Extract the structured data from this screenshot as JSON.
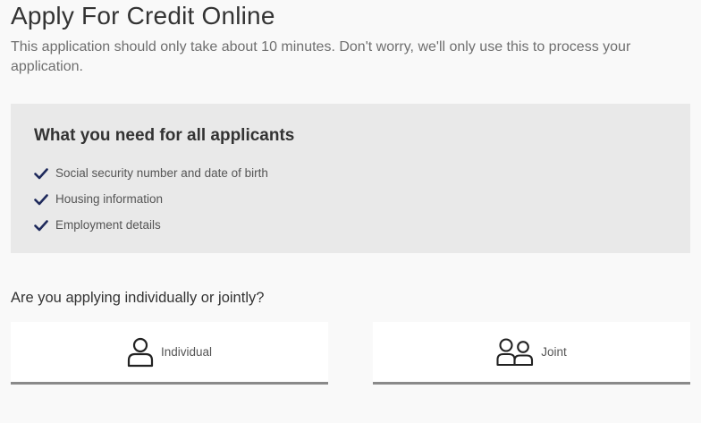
{
  "page": {
    "title": "Apply For Credit Online",
    "subtitle": "This application should only take about 10 minutes. Don't worry, we'll only use this to process your application."
  },
  "requirements": {
    "heading": "What you need for all applicants",
    "items": [
      {
        "label": "Social security number and date of birth",
        "icon": "check-icon"
      },
      {
        "label": "Housing information",
        "icon": "check-icon"
      },
      {
        "label": "Employment details",
        "icon": "check-icon"
      }
    ],
    "check_color": "#1f2a5c"
  },
  "applicant_type": {
    "question": "Are you applying individually or jointly?",
    "options": [
      {
        "label": "Individual",
        "icon": "person-icon"
      },
      {
        "label": "Joint",
        "icon": "two-people-icon"
      }
    ]
  }
}
